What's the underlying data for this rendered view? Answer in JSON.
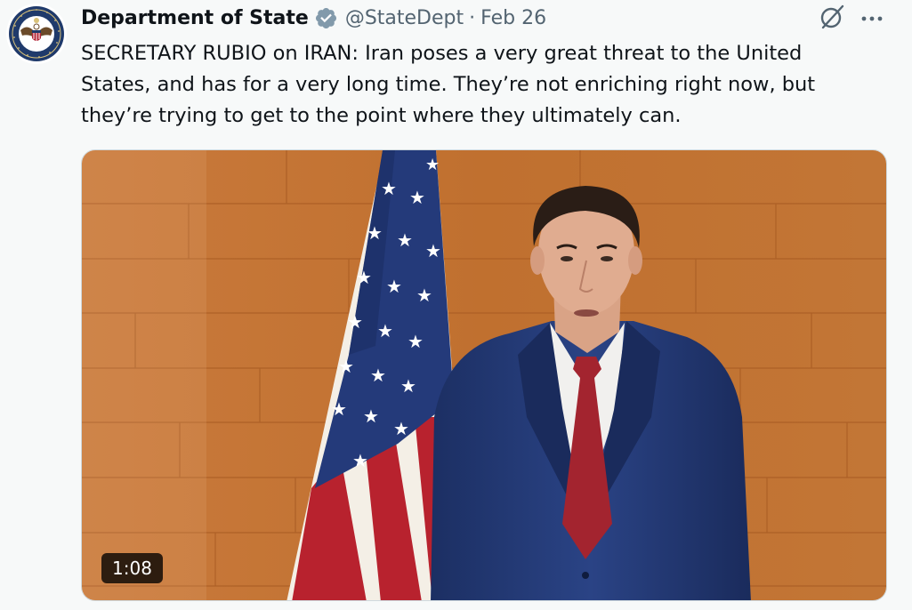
{
  "tweet": {
    "author": {
      "display_name": "Department of State",
      "handle": "@StateDept",
      "avatar_icon": "department-of-state-seal-icon",
      "verified_icon": "verified-badge-icon",
      "verified_color": "#829aab"
    },
    "separator": "·",
    "date": "Feb 26",
    "text": "SECRETARY RUBIO on IRAN: Iran poses a very great threat to the United\nStates, and has for a very long time. They’re not enriching right now, but\nthey’re trying to get to the point where they ultimately can.",
    "actions": {
      "grok_icon": "grok-icon",
      "more_icon": "more-options-icon"
    },
    "media": {
      "type": "video",
      "duration": "1:08"
    }
  }
}
